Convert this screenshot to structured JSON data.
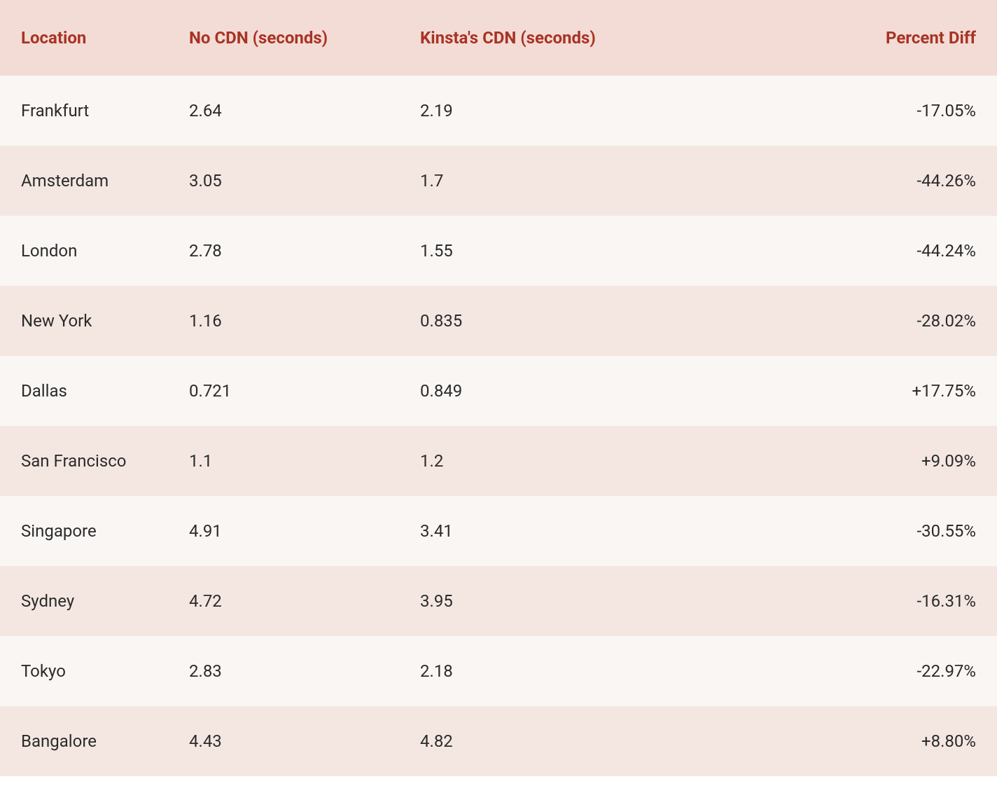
{
  "table": {
    "headers": {
      "location": "Location",
      "no_cdn": "No CDN (seconds)",
      "kinsta_cdn": "Kinsta's CDN (seconds)",
      "percent_diff": "Percent Diff"
    },
    "rows": [
      {
        "location": "Frankfurt",
        "no_cdn": "2.64",
        "kinsta_cdn": "2.19",
        "percent_diff": "-17.05%"
      },
      {
        "location": "Amsterdam",
        "no_cdn": "3.05",
        "kinsta_cdn": "1.7",
        "percent_diff": "-44.26%"
      },
      {
        "location": "London",
        "no_cdn": "2.78",
        "kinsta_cdn": "1.55",
        "percent_diff": "-44.24%"
      },
      {
        "location": "New York",
        "no_cdn": "1.16",
        "kinsta_cdn": "0.835",
        "percent_diff": "-28.02%"
      },
      {
        "location": "Dallas",
        "no_cdn": "0.721",
        "kinsta_cdn": "0.849",
        "percent_diff": "+17.75%"
      },
      {
        "location": "San Francisco",
        "no_cdn": "1.1",
        "kinsta_cdn": "1.2",
        "percent_diff": "+9.09%"
      },
      {
        "location": "Singapore",
        "no_cdn": "4.91",
        "kinsta_cdn": "3.41",
        "percent_diff": "-30.55%"
      },
      {
        "location": "Sydney",
        "no_cdn": "4.72",
        "kinsta_cdn": "3.95",
        "percent_diff": "-16.31%"
      },
      {
        "location": "Tokyo",
        "no_cdn": "2.83",
        "kinsta_cdn": "2.18",
        "percent_diff": "-22.97%"
      },
      {
        "location": "Bangalore",
        "no_cdn": "4.43",
        "kinsta_cdn": "4.82",
        "percent_diff": "+8.80%"
      }
    ]
  },
  "chart_data": {
    "type": "table",
    "title": "",
    "columns": [
      "Location",
      "No CDN (seconds)",
      "Kinsta's CDN (seconds)",
      "Percent Diff"
    ],
    "data": [
      [
        "Frankfurt",
        2.64,
        2.19,
        -17.05
      ],
      [
        "Amsterdam",
        3.05,
        1.7,
        -44.26
      ],
      [
        "London",
        2.78,
        1.55,
        -44.24
      ],
      [
        "New York",
        1.16,
        0.835,
        -28.02
      ],
      [
        "Dallas",
        0.721,
        0.849,
        17.75
      ],
      [
        "San Francisco",
        1.1,
        1.2,
        9.09
      ],
      [
        "Singapore",
        4.91,
        3.41,
        -30.55
      ],
      [
        "Sydney",
        4.72,
        3.95,
        -16.31
      ],
      [
        "Tokyo",
        2.83,
        2.18,
        -22.97
      ],
      [
        "Bangalore",
        4.43,
        4.82,
        8.8
      ]
    ]
  }
}
